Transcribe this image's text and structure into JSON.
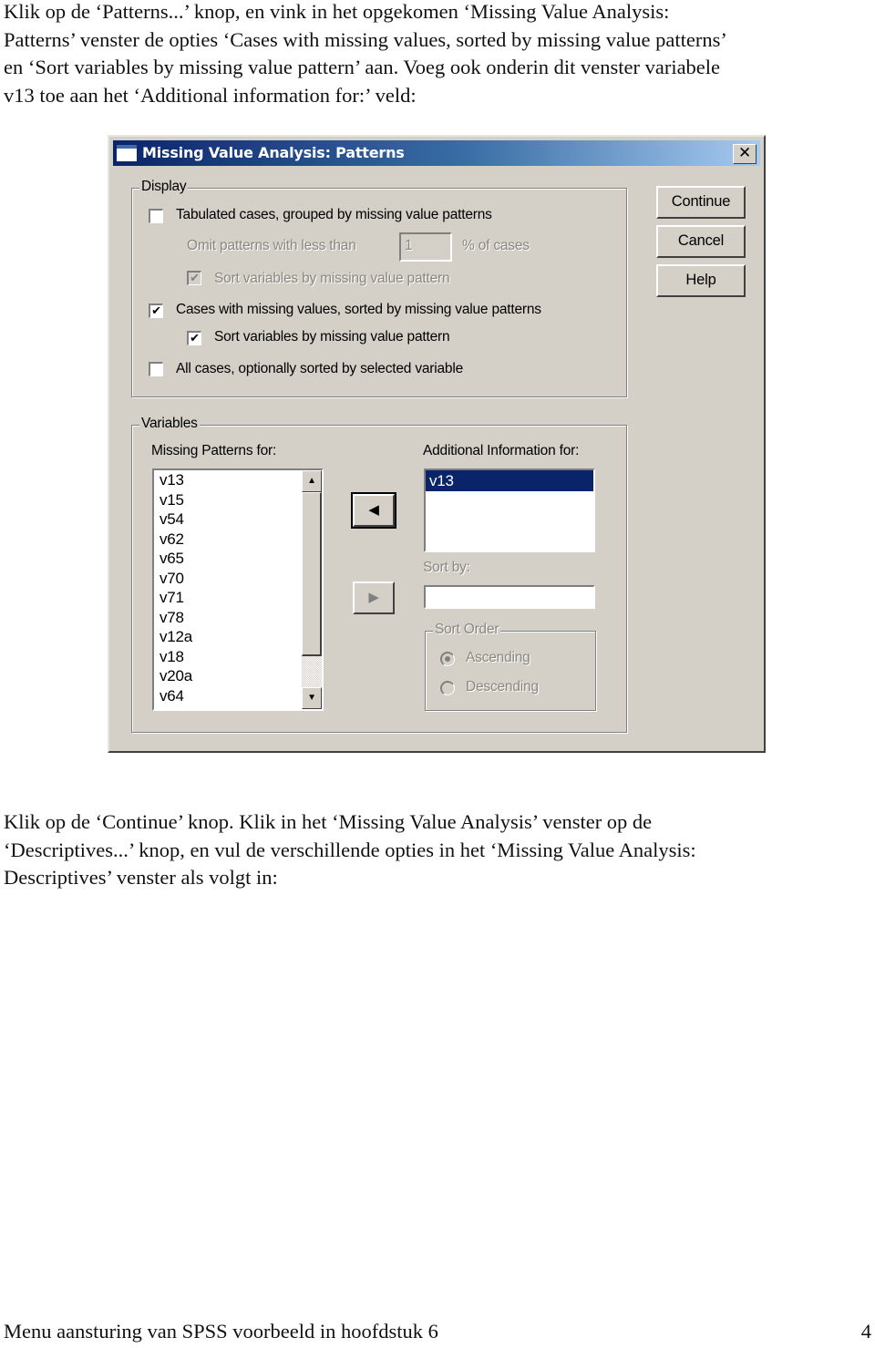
{
  "document": {
    "paragraph1": [
      "Klik op de ‘Patterns...’ knop, en vink in het opgekomen ‘Missing Value Analysis:",
      "Patterns’ venster de opties ‘Cases with missing values, sorted by missing value patterns’",
      "en ‘Sort variables by missing value pattern’ aan. Voeg ook onderin dit venster variabele",
      "v13 toe aan het ‘Additional information for:’ veld:"
    ],
    "paragraph2": [
      "Klik op de ‘Continue’ knop. Klik in het ‘Missing Value Analysis’ venster op de",
      "‘Descriptives...’ knop, en vul de verschillende opties in het  ‘Missing Value Analysis:",
      "Descriptives’ venster als volgt in:"
    ],
    "footer": {
      "left": "Menu aansturing van SPSS voorbeeld in hoofdstuk 6",
      "page_number": "4"
    }
  },
  "dialog": {
    "title": "Missing Value Analysis: Patterns",
    "close_symbol": "✕",
    "buttons": {
      "continue": "Continue",
      "cancel": "Cancel",
      "help": "Help"
    },
    "display": {
      "label": "Display",
      "tabulated": {
        "label": "Tabulated cases, grouped by missing value patterns",
        "checked": false,
        "enabled": true
      },
      "omit_label": "Omit patterns with less than",
      "omit_value": "1",
      "omit_suffix": "% of cases",
      "sort_vars_tabulated": {
        "label": "Sort variables by missing value pattern",
        "checked": true,
        "enabled": false
      },
      "cases_missing": {
        "label": "Cases with missing values, sorted by missing value patterns",
        "checked": true,
        "enabled": true
      },
      "sort_vars_cases": {
        "label": "Sort variables by missing value pattern",
        "checked": true,
        "enabled": true
      },
      "all_cases": {
        "label": "All cases, optionally sorted by selected variable",
        "checked": false,
        "enabled": true
      }
    },
    "variables": {
      "label": "Variables",
      "missing_patterns_label": "Missing Patterns for:",
      "missing_patterns_items": [
        "v13",
        "v15",
        "v54",
        "v62",
        "v65",
        "v70",
        "v71",
        "v78",
        "v12a",
        "v18",
        "v20a",
        "v64"
      ],
      "additional_label": "Additional Information for:",
      "additional_items": [
        "v13"
      ],
      "sort_by_label": "Sort by:",
      "sort_by_value": "",
      "sort_order": {
        "label": "Sort Order",
        "ascending": "Ascending",
        "descending": "Descending",
        "selected": "Ascending"
      },
      "move_left_symbol": "◀",
      "move_right_symbol": "▶"
    },
    "checkmark": "✔",
    "scroll_up": "▲",
    "scroll_down": "▼"
  }
}
